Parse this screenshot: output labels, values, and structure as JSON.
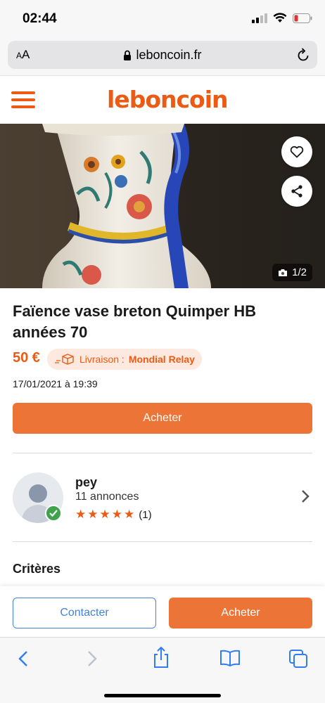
{
  "status": {
    "time": "02:44"
  },
  "browser": {
    "aa_label_small": "A",
    "aa_label": "A",
    "url": "leboncoin.fr"
  },
  "header": {
    "logo": "leboncoin"
  },
  "gallery": {
    "photo_counter": "1/2"
  },
  "listing": {
    "title": "Faïence vase breton Quimper HB années 70",
    "price": "50 €",
    "delivery_label": "Livraison : ",
    "delivery_carrier": "Mondial Relay",
    "date": "17/01/2021 à 19:39",
    "buy_label": "Acheter"
  },
  "seller": {
    "name": "pey",
    "ads_count": "11 annonces",
    "stars": 5,
    "reviews": "(1)"
  },
  "sections": {
    "criteria": "Critères"
  },
  "action_bar": {
    "contact_label": "Contacter",
    "buy_label": "Acheter"
  },
  "colors": {
    "brand": "#ec5a13",
    "button": "#ec7437",
    "link": "#4183d7",
    "verified": "#3fa34d"
  },
  "icons": [
    "signal-icon",
    "wifi-icon",
    "battery-icon",
    "lock-icon",
    "reload-icon",
    "menu-icon",
    "heart-icon",
    "share-icon",
    "camera-icon",
    "delivery-box-icon",
    "verified-icon",
    "chevron-right-icon",
    "back-icon",
    "forward-icon",
    "share-tray-icon",
    "bookmarks-icon",
    "tabs-icon"
  ]
}
